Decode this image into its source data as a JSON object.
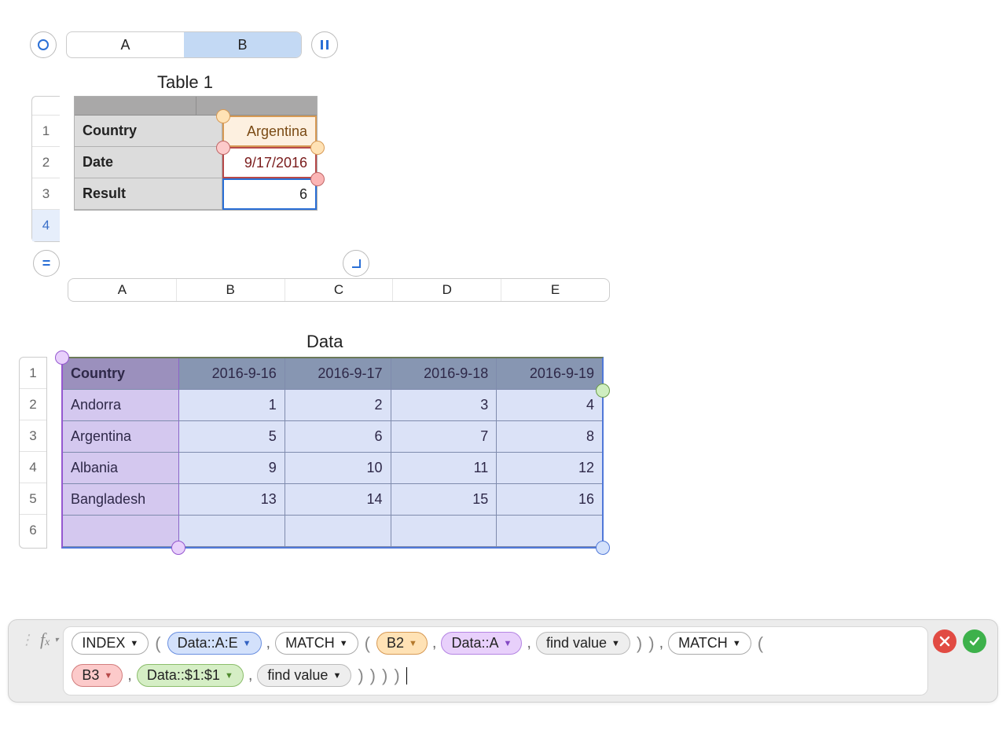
{
  "topbar": {
    "cols": [
      "A",
      "B"
    ],
    "selected": "B"
  },
  "table1": {
    "title": "Table 1",
    "rows": [
      {
        "label": "Country",
        "value": "Argentina"
      },
      {
        "label": "Date",
        "value": "9/17/2016"
      },
      {
        "label": "Result",
        "value": "6"
      }
    ],
    "rownums": [
      "1",
      "2",
      "3",
      "4"
    ]
  },
  "dataCols": [
    "A",
    "B",
    "C",
    "D",
    "E"
  ],
  "data": {
    "title": "Data",
    "rownums": [
      "1",
      "2",
      "3",
      "4",
      "5",
      "6"
    ],
    "headers": [
      "Country",
      "2016-9-16",
      "2016-9-17",
      "2016-9-18",
      "2016-9-19"
    ],
    "rows": [
      [
        "Andorra",
        "1",
        "2",
        "3",
        "4"
      ],
      [
        "Argentina",
        "5",
        "6",
        "7",
        "8"
      ],
      [
        "Albania",
        "9",
        "10",
        "11",
        "12"
      ],
      [
        "Bangladesh",
        "13",
        "14",
        "15",
        "16"
      ],
      [
        "",
        "",
        "",
        "",
        ""
      ]
    ]
  },
  "formula": {
    "tokens_line1": [
      {
        "t": "fn",
        "text": "INDEX"
      },
      {
        "t": "open"
      },
      {
        "t": "ref",
        "cls": "blue",
        "text": "Data::A:E"
      },
      {
        "t": "comma"
      },
      {
        "t": "fn",
        "text": "MATCH"
      },
      {
        "t": "open"
      },
      {
        "t": "ref",
        "cls": "orange",
        "text": "B2"
      },
      {
        "t": "comma"
      },
      {
        "t": "ref",
        "cls": "purple",
        "text": "Data::A"
      },
      {
        "t": "comma"
      },
      {
        "t": "ref",
        "cls": "gray",
        "text": "find value"
      },
      {
        "t": "close"
      },
      {
        "t": "close"
      },
      {
        "t": "comma"
      },
      {
        "t": "fn",
        "text": "MATCH"
      },
      {
        "t": "open"
      }
    ],
    "tokens_line2": [
      {
        "t": "ref",
        "cls": "pink",
        "text": "B3"
      },
      {
        "t": "comma"
      },
      {
        "t": "ref",
        "cls": "green",
        "text": "Data::$1:$1"
      },
      {
        "t": "comma"
      },
      {
        "t": "ref",
        "cls": "gray",
        "text": "find value"
      },
      {
        "t": "close"
      },
      {
        "t": "close"
      },
      {
        "t": "close"
      },
      {
        "t": "close"
      },
      {
        "t": "caret"
      }
    ]
  }
}
